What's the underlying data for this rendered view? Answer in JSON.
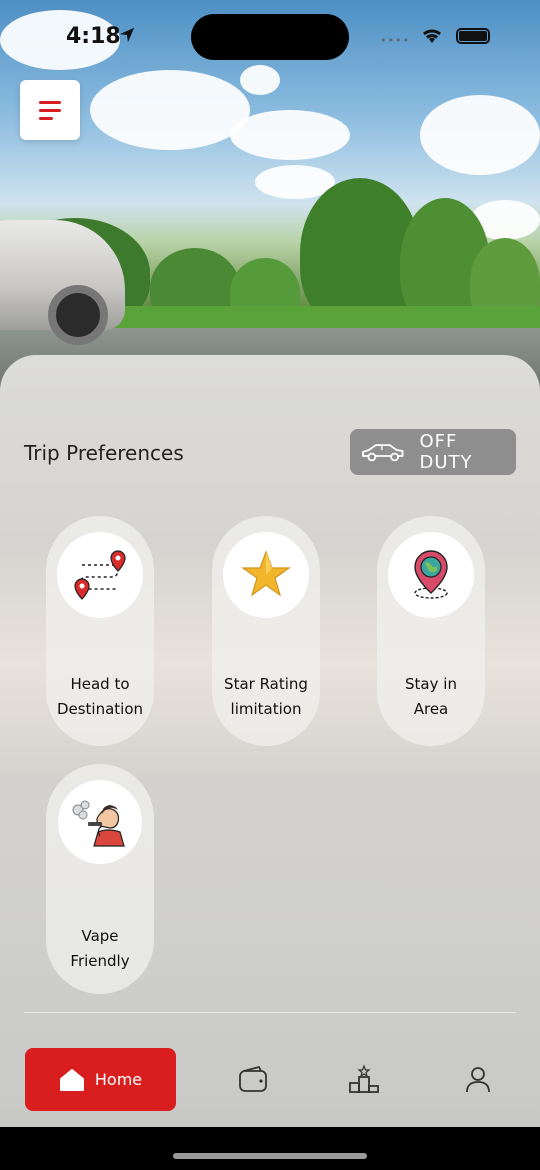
{
  "status_bar": {
    "time": "4:18"
  },
  "section_title": "Trip Preferences",
  "duty_button": {
    "label": "OFF DUTY"
  },
  "preferences": [
    {
      "line1": "Head to",
      "line2": "Destination",
      "icon": "route-pins-icon"
    },
    {
      "line1": "Star Rating",
      "line2": "limitation",
      "icon": "star-icon"
    },
    {
      "line1": "Stay in",
      "line2": "Area",
      "icon": "globe-pin-icon"
    },
    {
      "line1": "Vape",
      "line2": "Friendly",
      "icon": "vape-person-icon"
    }
  ],
  "tabs": {
    "home_label": "Home"
  },
  "colors": {
    "accent": "#d81e1e",
    "duty_bg": "#8e8e8e"
  }
}
